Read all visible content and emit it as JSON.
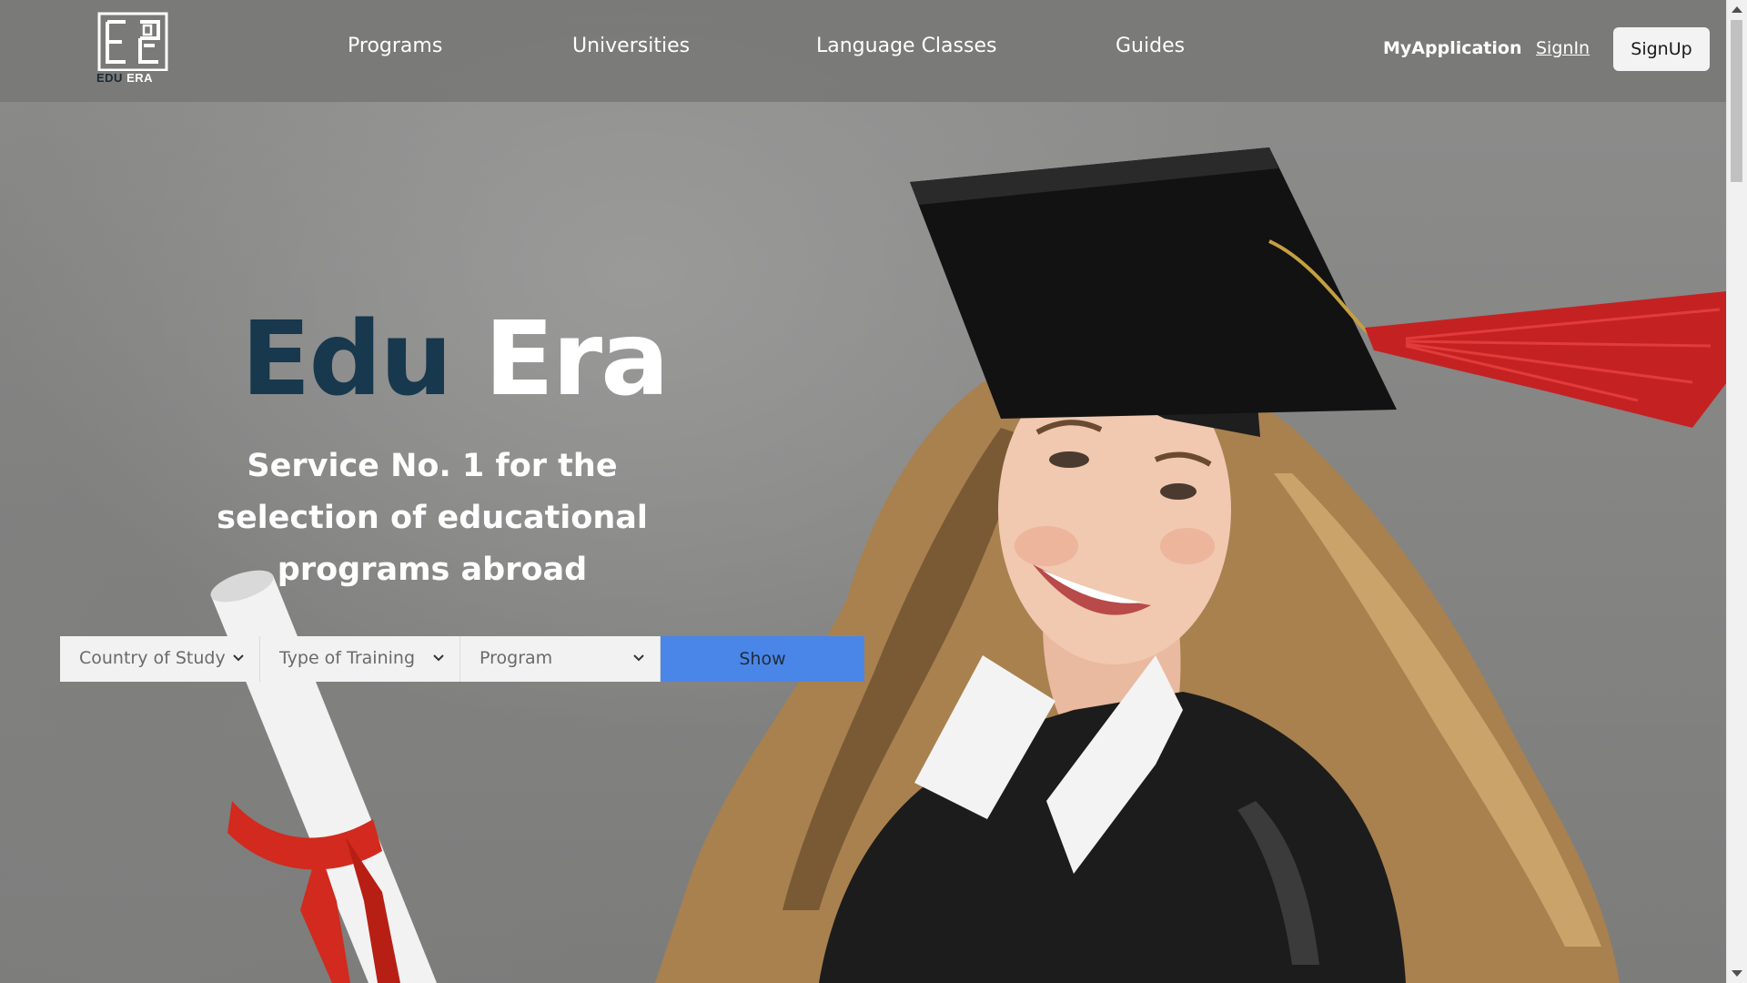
{
  "header": {
    "logo_text_left": "EDU",
    "logo_text_right": "ERA",
    "nav": [
      {
        "label": "Programs"
      },
      {
        "label": "Universities"
      },
      {
        "label": "Language Classes"
      },
      {
        "label": "Guides"
      }
    ],
    "my_application": "MyApplication",
    "sign_in": "SignIn",
    "sign_up": "SignUp"
  },
  "hero": {
    "title_part1": "Edu",
    "title_part2": "Era",
    "subtitle": "Service No. 1 for the selection of educational programs abroad"
  },
  "search": {
    "country_select": "Country of Study",
    "training_select": "Type of Training",
    "program_select": "Program",
    "show_button": "Show"
  },
  "colors": {
    "accent_blue": "#4a86e8",
    "title_dark": "#17384d",
    "header_bg": "#787877"
  },
  "icons": {
    "chevron": "chevron-down-icon",
    "logo": "edu-era-logo"
  }
}
